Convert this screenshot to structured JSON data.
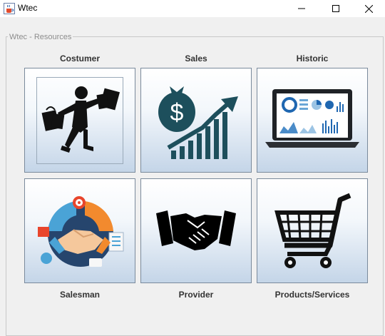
{
  "window": {
    "title": "Wtec",
    "app_icon": "java-coffee-icon",
    "controls": [
      "minimize-icon",
      "maximize-icon",
      "close-icon"
    ]
  },
  "group": {
    "legend": "Wtec - Resources"
  },
  "tiles": [
    {
      "label": "Costumer",
      "icon": "shopping-person-icon"
    },
    {
      "label": "Sales",
      "icon": "money-growth-icon"
    },
    {
      "label": "Historic",
      "icon": "laptop-dashboard-icon"
    },
    {
      "label": "Salesman",
      "icon": "handshake-infographic-icon"
    },
    {
      "label": "Provider",
      "icon": "handshake-icon"
    },
    {
      "label": "Products/Services",
      "icon": "shopping-cart-icon"
    }
  ]
}
